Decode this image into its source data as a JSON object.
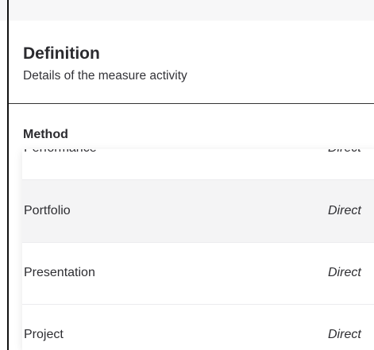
{
  "definition": {
    "title": "Definition",
    "subtitle": "Details of the measure activity"
  },
  "method": {
    "label": "Method",
    "options": [
      {
        "label": "Performance",
        "type": "Direct"
      },
      {
        "label": "Portfolio",
        "type": "Direct",
        "highlighted": true
      },
      {
        "label": "Presentation",
        "type": "Direct"
      },
      {
        "label": "Project",
        "type": "Direct"
      }
    ]
  },
  "colors": {
    "highlight": "#f4f4f5",
    "text": "#2d2d31",
    "divider": "#333333"
  }
}
